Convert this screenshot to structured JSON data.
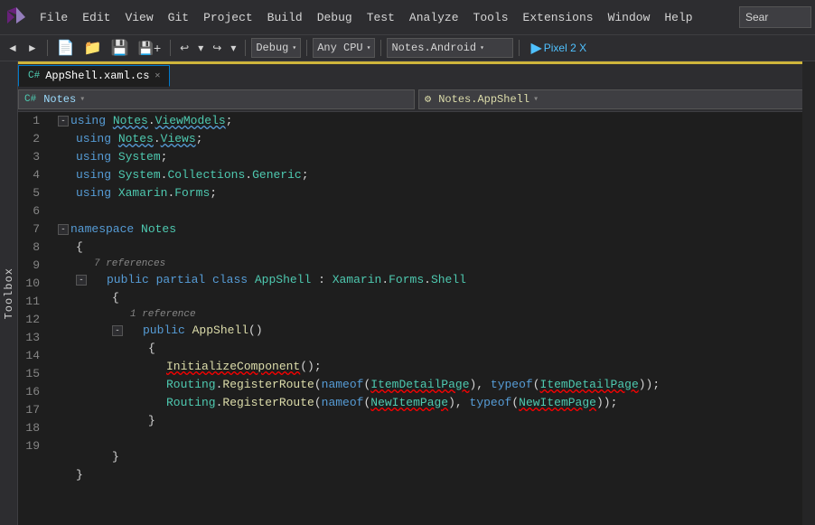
{
  "menu": {
    "items": [
      "File",
      "Edit",
      "View",
      "Git",
      "Project",
      "Build",
      "Debug",
      "Test",
      "Analyze",
      "Tools",
      "Extensions",
      "Window",
      "Help"
    ],
    "search_placeholder": "Sear"
  },
  "toolbar": {
    "debug_label": "Debug",
    "cpu_label": "Any CPU",
    "project_label": "Notes.Android",
    "run_label": "Pixel 2 X",
    "debug_arrow": "▾",
    "cpu_arrow": "▾",
    "project_arrow": "▾"
  },
  "toolbox": {
    "label": "Toolbox"
  },
  "tabs": [
    {
      "name": "AppShell.xaml.cs",
      "active": true,
      "modified": false
    },
    {
      "name": "Notes",
      "active": false
    }
  ],
  "nav_bar": {
    "class_value": "Notes",
    "method_value": "Notes.AppShell"
  },
  "code": {
    "lines": [
      {
        "num": 1,
        "content": "using Notes.ViewModels;"
      },
      {
        "num": 2,
        "content": "using Notes.Views;"
      },
      {
        "num": 3,
        "content": "using System;"
      },
      {
        "num": 4,
        "content": "using System.Collections.Generic;"
      },
      {
        "num": 5,
        "content": "using Xamarin.Forms;"
      },
      {
        "num": 6,
        "content": ""
      },
      {
        "num": 7,
        "content": "namespace Notes"
      },
      {
        "num": 8,
        "content": "{"
      },
      {
        "num": 9,
        "content": "public partial class AppShell : Xamarin.Forms.Shell"
      },
      {
        "num": 10,
        "content": "{"
      },
      {
        "num": 11,
        "content": "public AppShell()"
      },
      {
        "num": 12,
        "content": "{"
      },
      {
        "num": 13,
        "content": "InitializeComponent();"
      },
      {
        "num": 14,
        "content": "Routing.RegisterRoute(nameof(ItemDetailPage), typeof(ItemDetailPage));"
      },
      {
        "num": 15,
        "content": "Routing.RegisterRoute(nameof(NewItemPage), typeof(NewItemPage));"
      },
      {
        "num": 16,
        "content": "}"
      },
      {
        "num": 17,
        "content": ""
      },
      {
        "num": 18,
        "content": "}"
      },
      {
        "num": 19,
        "content": "}"
      }
    ],
    "ref_7": "7 references",
    "ref_11": "1 reference"
  },
  "colors": {
    "accent": "#007acc",
    "golden": "#cfb53b",
    "bg": "#1e1e1e",
    "tab_bg": "#2d2d30"
  }
}
